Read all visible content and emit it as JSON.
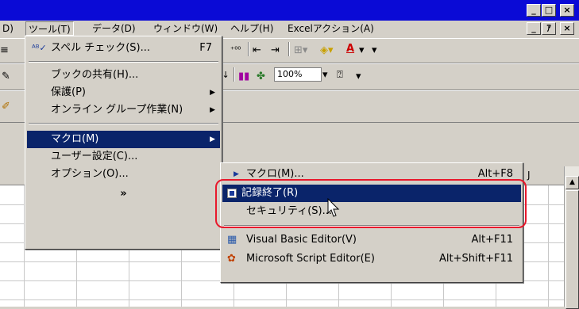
{
  "window": {
    "min": "_",
    "max": "□",
    "close": "×",
    "doc_restore": "ｱ"
  },
  "menubar": {
    "partial_item": "D)",
    "items": [
      "ツール(T)",
      "データ(D)",
      "ウィンドウ(W)",
      "ヘルプ(H)",
      "Excelアクション(A)"
    ]
  },
  "toolbar": {
    "zoom": "100%",
    "font_color_letter": "A",
    "sort_az": "Z↓"
  },
  "tools_menu": {
    "items": [
      {
        "label": "スペル チェック(S)...",
        "shortcut": "F7"
      },
      {
        "label": "ブックの共有(H)..."
      },
      {
        "label": "保護(P)",
        "submenu": true
      },
      {
        "label": "オンライン グループ作業(N)",
        "submenu": true
      },
      {
        "label": "マクロ(M)",
        "submenu": true,
        "highlighted": true
      },
      {
        "label": "ユーザー設定(C)..."
      },
      {
        "label": "オプション(O)..."
      }
    ],
    "expand": "»"
  },
  "macro_submenu": {
    "items": [
      {
        "label": "マクロ(M)...",
        "shortcut": "Alt+F8"
      },
      {
        "label": "記録終了(R)",
        "highlighted": true
      },
      {
        "label": "セキュリティ(S)..."
      },
      {
        "label": "Visual Basic Editor(V)",
        "shortcut": "Alt+F11"
      },
      {
        "label": "Microsoft Script Editor(E)",
        "shortcut": "Alt+Shift+F11"
      }
    ]
  },
  "grid": {
    "col_header_visible": "J"
  },
  "colors": {
    "titlebar": "#0a0ad6",
    "highlight": "#0a246a",
    "annotation": "#e8192c"
  }
}
